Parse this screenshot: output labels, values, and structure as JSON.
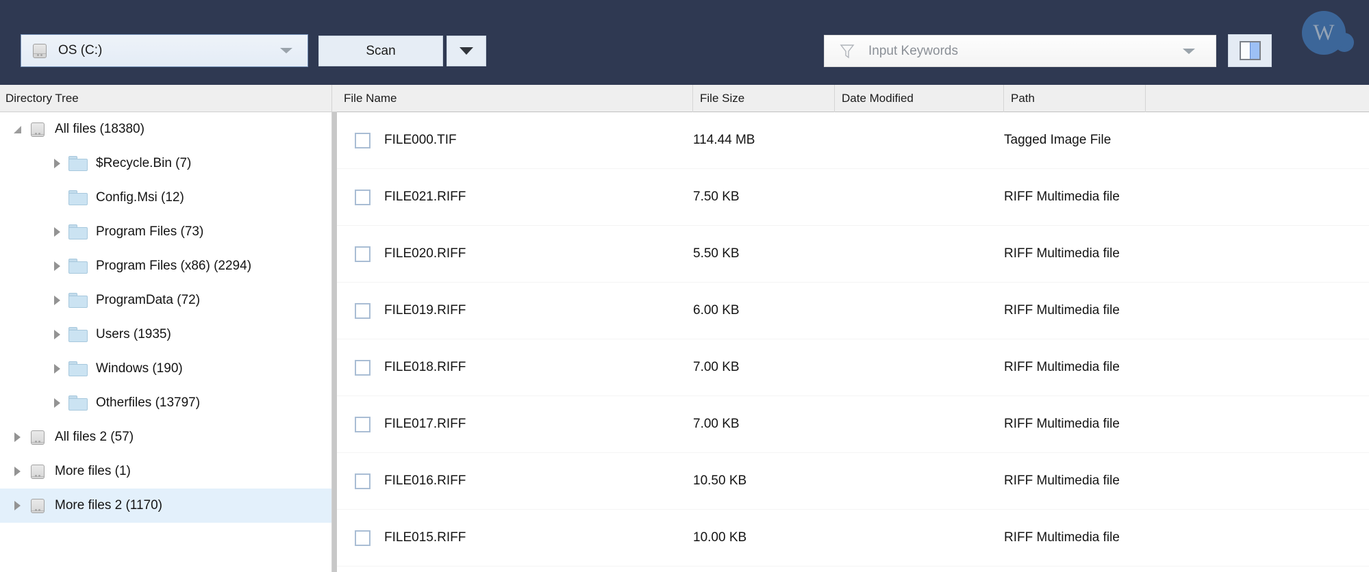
{
  "toolbar": {
    "drive": {
      "label": "OS (C:)",
      "icon": "drive-icon",
      "caret": "chevron-down-icon"
    },
    "scan": {
      "label": "Scan",
      "caret": "chevron-down-icon"
    },
    "keyword": {
      "placeholder": "Input Keywords",
      "value": "",
      "icon": "filter-funnel-icon",
      "caret": "chevron-down-icon"
    },
    "view_toggle": {
      "icon": "split-view-icon"
    },
    "avatar": {
      "initial": "W",
      "color": "#3c6699"
    },
    "background": "#2f3952"
  },
  "tree": {
    "header": "Directory Tree",
    "items": [
      {
        "label": "All files (18380)",
        "icon": "drive-icon",
        "arrow": "triangle-down",
        "indent": 0,
        "selected": false
      },
      {
        "label": "$Recycle.Bin (7)",
        "icon": "folder-icon",
        "arrow": "triangle-right",
        "indent": 1,
        "selected": false
      },
      {
        "label": "Config.Msi (12)",
        "icon": "folder-icon",
        "arrow": "none",
        "indent": 1,
        "selected": false
      },
      {
        "label": "Program Files (73)",
        "icon": "folder-icon",
        "arrow": "triangle-right",
        "indent": 1,
        "selected": false
      },
      {
        "label": "Program Files (x86) (2294)",
        "icon": "folder-icon",
        "arrow": "triangle-right",
        "indent": 1,
        "selected": false
      },
      {
        "label": "ProgramData (72)",
        "icon": "folder-icon",
        "arrow": "triangle-right",
        "indent": 1,
        "selected": false
      },
      {
        "label": "Users (1935)",
        "icon": "folder-icon",
        "arrow": "triangle-right",
        "indent": 1,
        "selected": false
      },
      {
        "label": "Windows (190)",
        "icon": "folder-icon",
        "arrow": "triangle-right",
        "indent": 1,
        "selected": false
      },
      {
        "label": "Otherfiles (13797)",
        "icon": "folder-icon",
        "arrow": "triangle-right",
        "indent": 1,
        "selected": false
      },
      {
        "label": "All files 2 (57)",
        "icon": "drive-icon",
        "arrow": "triangle-right",
        "indent": 0,
        "selected": false
      },
      {
        "label": "More files (1)",
        "icon": "drive-icon",
        "arrow": "triangle-right",
        "indent": 0,
        "selected": false
      },
      {
        "label": "More files 2 (1170)",
        "icon": "drive-icon",
        "arrow": "triangle-right",
        "indent": 0,
        "selected": true
      }
    ]
  },
  "file_list": {
    "columns": [
      "File Name",
      "File Size",
      "Date Modified",
      "Path",
      ""
    ],
    "rows": [
      {
        "name": "FILE000.TIF",
        "size": "114.44 MB",
        "date": "",
        "path": "Tagged Image File",
        "checked": false
      },
      {
        "name": "FILE021.RIFF",
        "size": "7.50 KB",
        "date": "",
        "path": "RIFF Multimedia file",
        "checked": false
      },
      {
        "name": "FILE020.RIFF",
        "size": "5.50 KB",
        "date": "",
        "path": "RIFF Multimedia file",
        "checked": false
      },
      {
        "name": "FILE019.RIFF",
        "size": "6.00 KB",
        "date": "",
        "path": "RIFF Multimedia file",
        "checked": false
      },
      {
        "name": "FILE018.RIFF",
        "size": "7.00 KB",
        "date": "",
        "path": "RIFF Multimedia file",
        "checked": false
      },
      {
        "name": "FILE017.RIFF",
        "size": "7.00 KB",
        "date": "",
        "path": "RIFF Multimedia file",
        "checked": false
      },
      {
        "name": "FILE016.RIFF",
        "size": "10.50 KB",
        "date": "",
        "path": "RIFF Multimedia file",
        "checked": false
      },
      {
        "name": "FILE015.RIFF",
        "size": "10.00 KB",
        "date": "",
        "path": "RIFF Multimedia file",
        "checked": false
      }
    ]
  }
}
